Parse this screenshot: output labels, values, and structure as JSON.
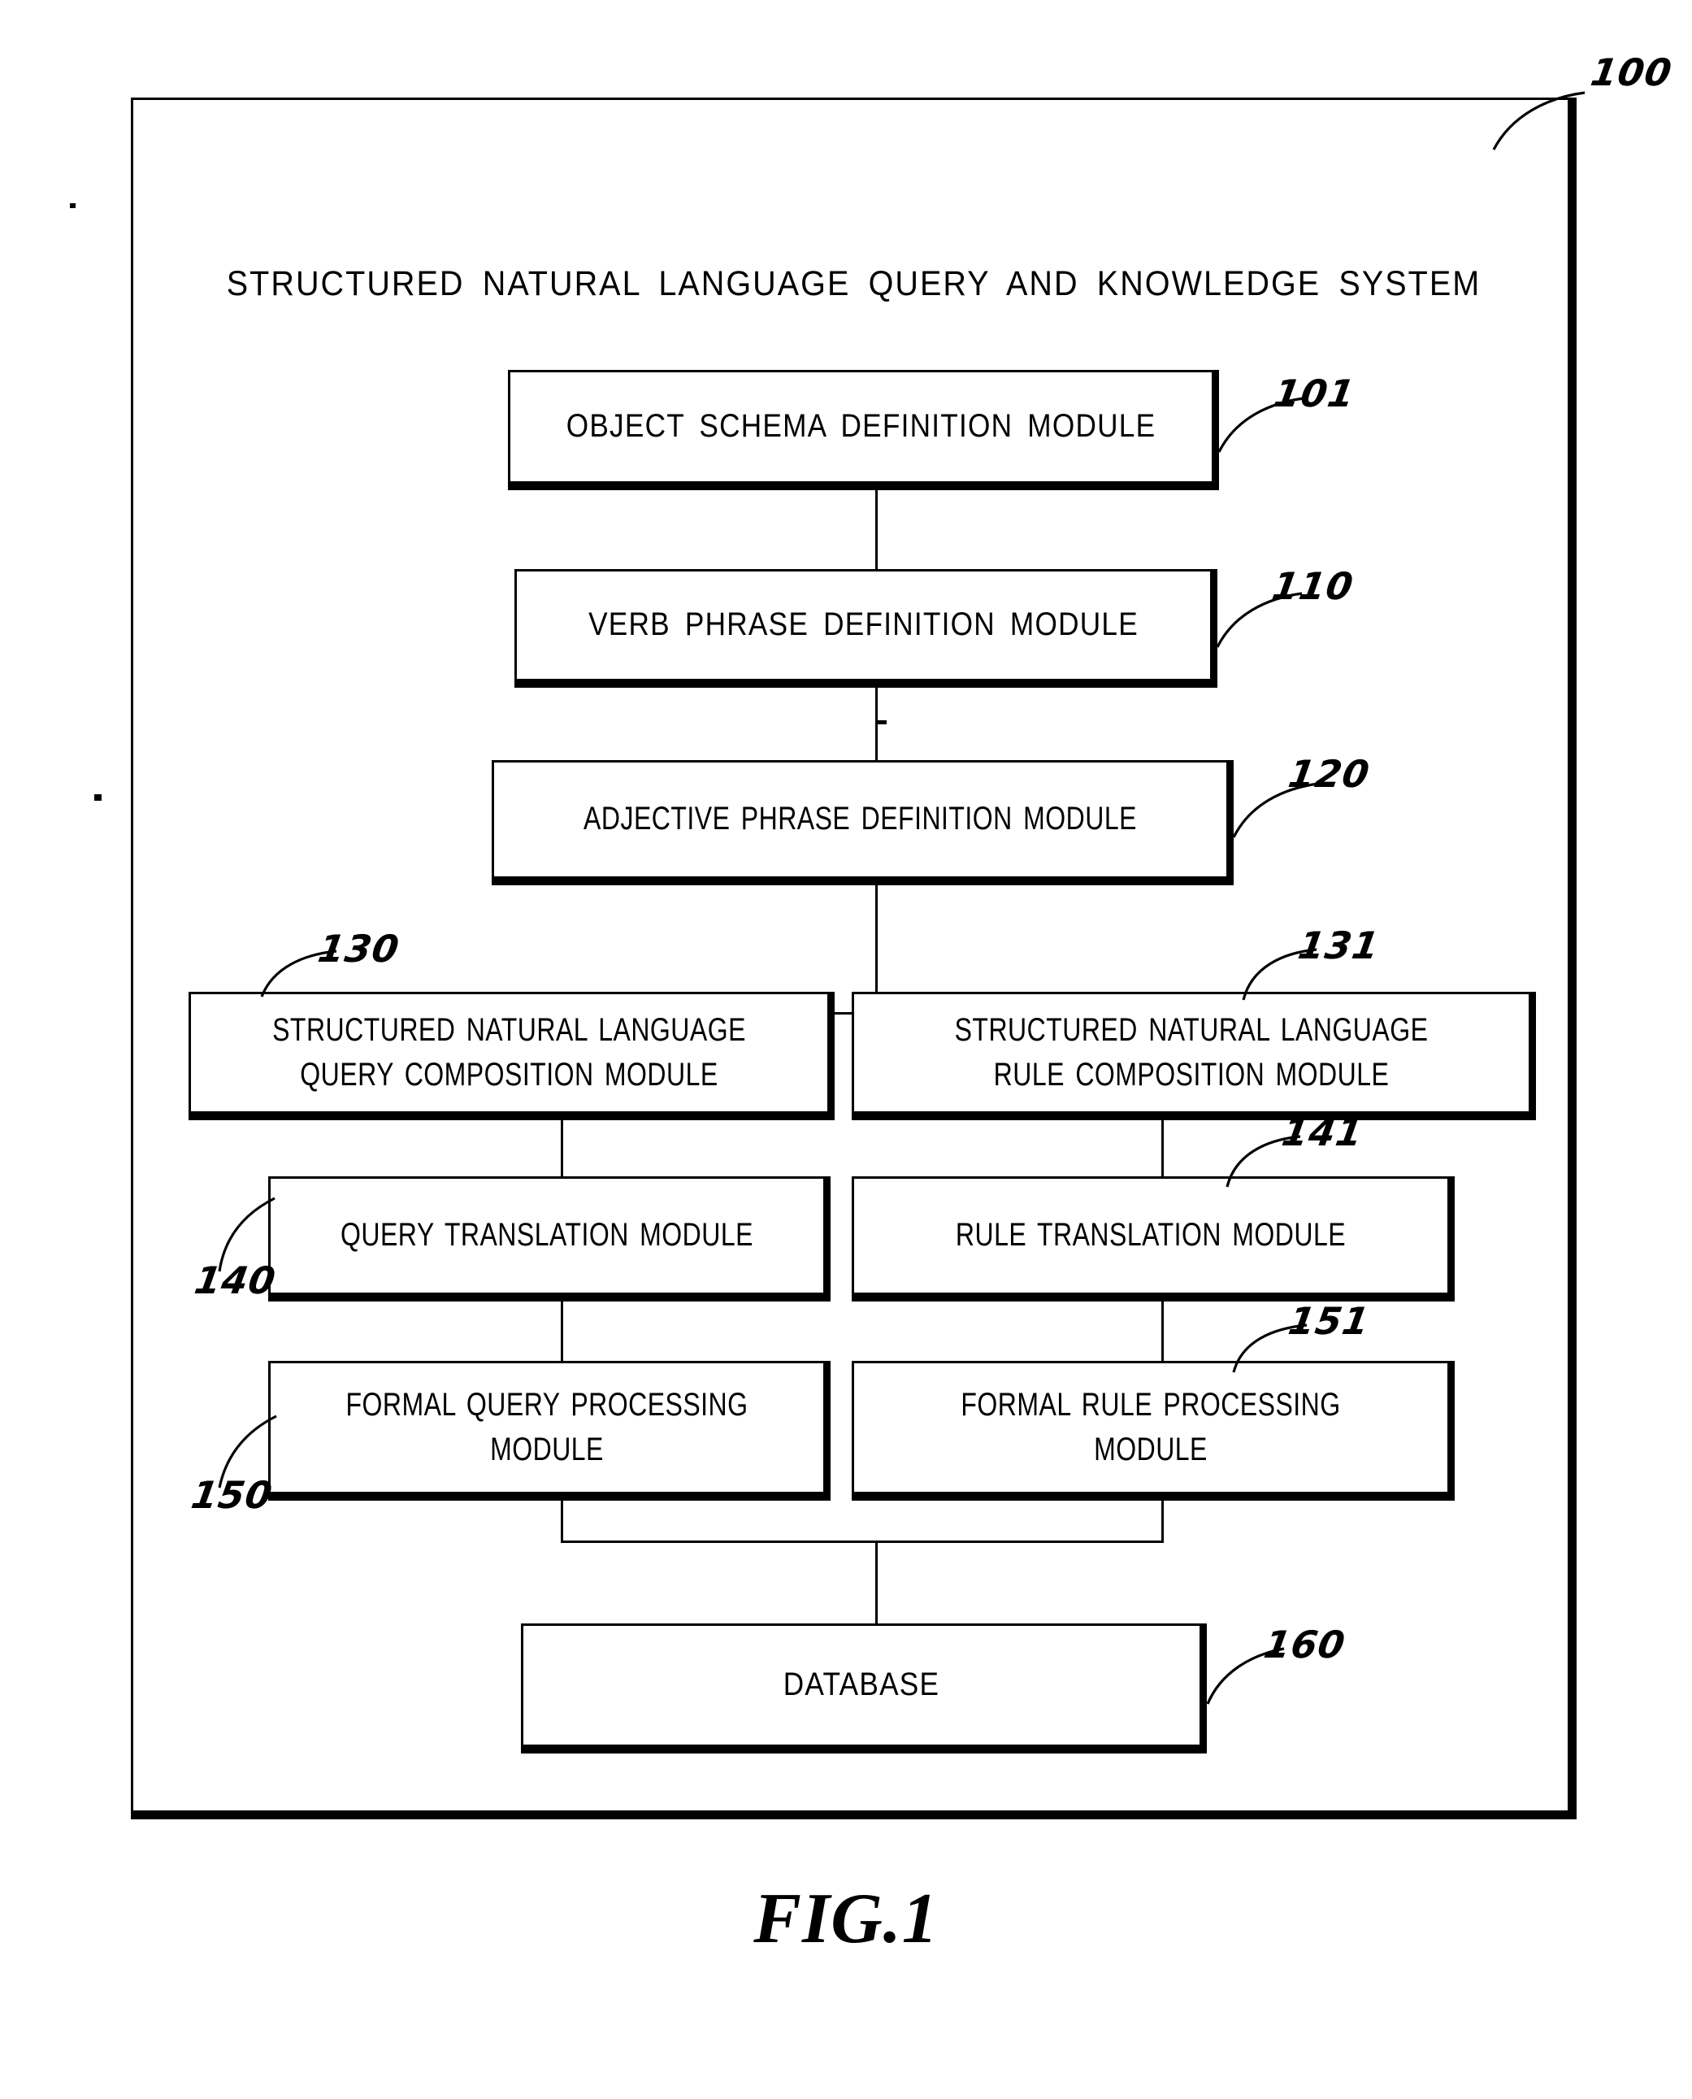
{
  "figure": {
    "caption": "FIG.1",
    "system_ref": "100",
    "title": "STRUCTURED NATURAL LANGUAGE QUERY AND KNOWLEDGE SYSTEM"
  },
  "modules": [
    {
      "id": "object-schema-definition",
      "label": "OBJECT SCHEMA DEFINITION MODULE",
      "ref": "101"
    },
    {
      "id": "verb-phrase-definition",
      "label": "VERB PHRASE DEFINITION MODULE",
      "ref": "110"
    },
    {
      "id": "adjective-phrase-definition",
      "label": "ADJECTIVE PHRASE DEFINITION MODULE",
      "ref": "120"
    },
    {
      "id": "snl-query-composition",
      "label": "STRUCTURED NATURAL LANGUAGE\nQUERY COMPOSITION MODULE",
      "ref": "130"
    },
    {
      "id": "snl-rule-composition",
      "label": "STRUCTURED NATURAL LANGUAGE\nRULE COMPOSITION MODULE",
      "ref": "131"
    },
    {
      "id": "query-translation",
      "label": "QUERY TRANSLATION MODULE",
      "ref": "140"
    },
    {
      "id": "rule-translation",
      "label": "RULE TRANSLATION MODULE",
      "ref": "141"
    },
    {
      "id": "formal-query-processing",
      "label": "FORMAL QUERY PROCESSING\nMODULE",
      "ref": "150"
    },
    {
      "id": "formal-rule-processing",
      "label": "FORMAL RULE PROCESSING\nMODULE",
      "ref": "151"
    },
    {
      "id": "database",
      "label": "DATABASE",
      "ref": "160"
    }
  ],
  "colors": {
    "ink": "#000000",
    "paper": "#ffffff"
  }
}
